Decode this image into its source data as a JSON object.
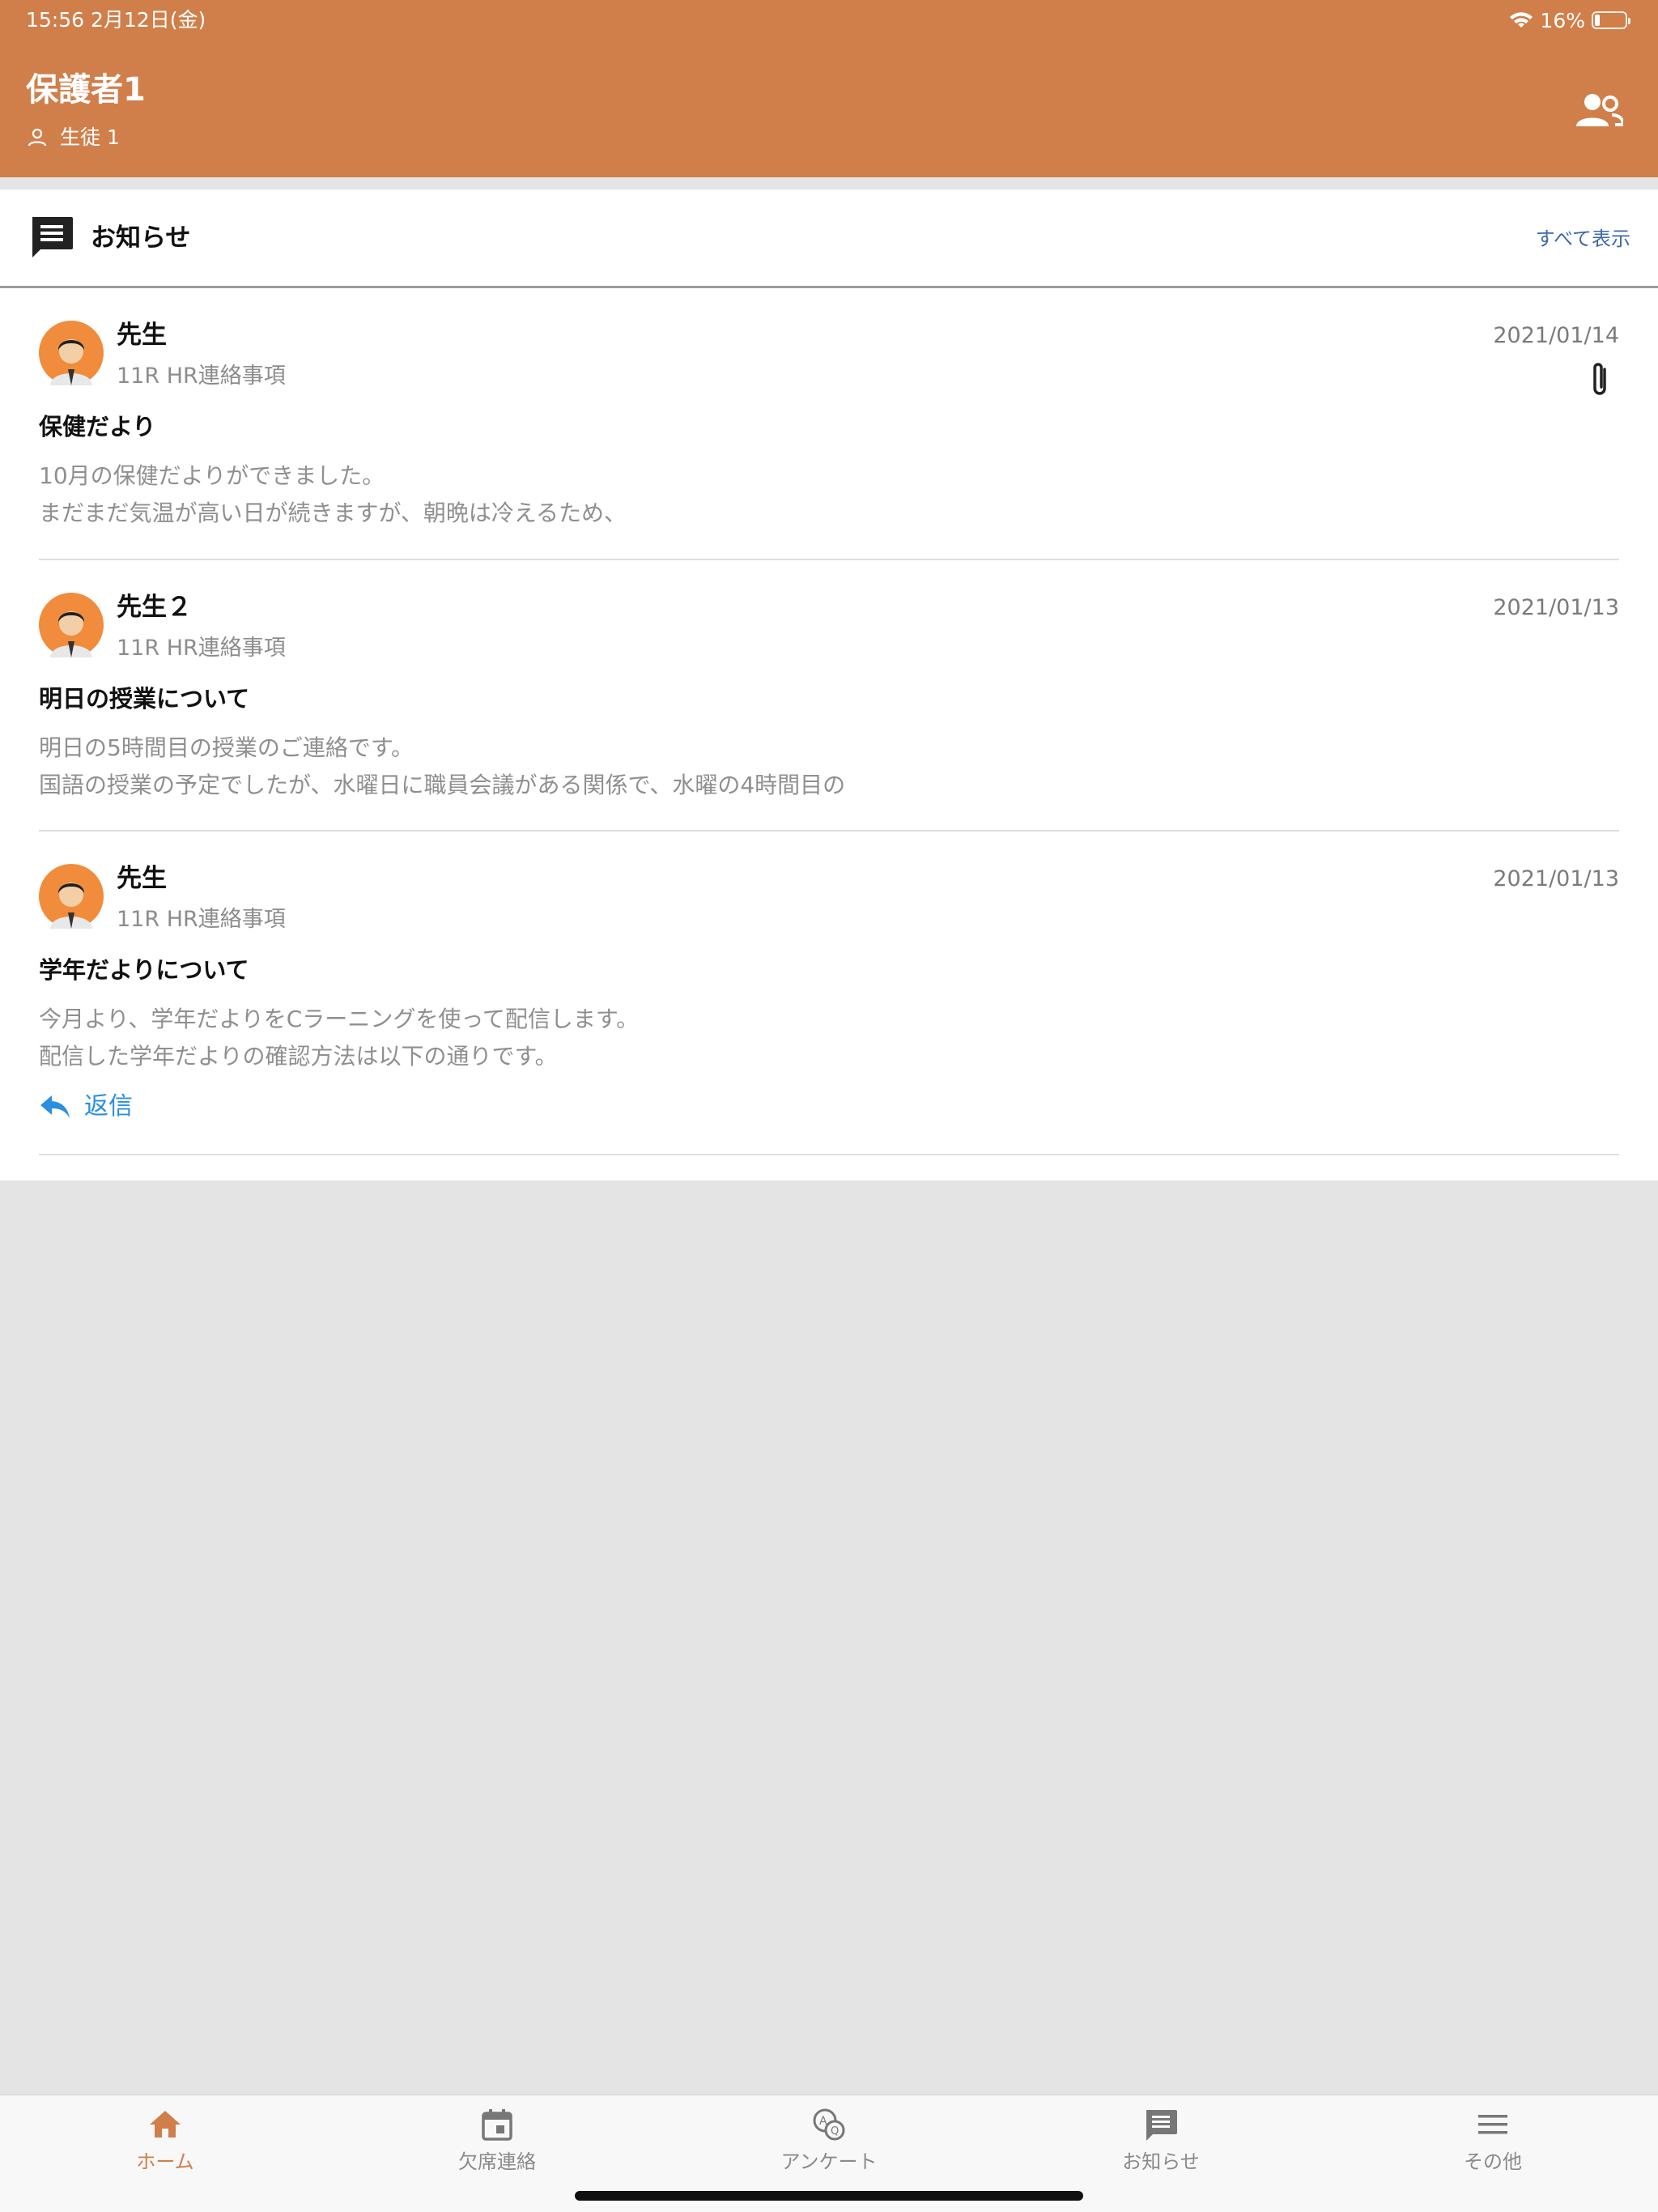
{
  "status_bar": {
    "time_date": "15:56   2月12日(金)",
    "battery_text": "16%",
    "battery_level": 0.16
  },
  "header": {
    "title": "保護者1",
    "student": "生徒 1",
    "background": "#d07f4b"
  },
  "notices": {
    "section_title": "お知らせ",
    "see_all": "すべて表示",
    "items": [
      {
        "sender": "先生",
        "category": "11R HR連絡事項",
        "date": "2021/01/14",
        "subject": "保健だより",
        "body": [
          "10月の保健だよりができました。",
          "まだまだ気温が高い日が続きますが、朝晩は冷えるため、"
        ],
        "has_attachment": true
      },
      {
        "sender": "先生２",
        "category": "11R HR連絡事項",
        "date": "2021/01/13",
        "subject": "明日の授業について",
        "body": [
          "明日の5時間目の授業のご連絡です。",
          "国語の授業の予定でしたが、水曜日に職員会議がある関係で、水曜の4時間目の"
        ],
        "has_attachment": false
      },
      {
        "sender": "先生",
        "category": "11R HR連絡事項",
        "date": "2021/01/13",
        "subject": "学年だよりについて",
        "body": [
          "今月より、学年だよりをCラーニングを使って配信します。",
          "配信した学年だよりの確認方法は以下の通りです。"
        ],
        "has_attachment": false,
        "reply_label": "返信"
      }
    ]
  },
  "tabbar": {
    "active_color": "#d07f4b",
    "tabs": [
      {
        "label": "ホーム",
        "icon": "home-icon",
        "active": true
      },
      {
        "label": "欠席連絡",
        "icon": "calendar-icon",
        "active": false
      },
      {
        "label": "アンケート",
        "icon": "survey-icon",
        "active": false
      },
      {
        "label": "お知らせ",
        "icon": "message-icon",
        "active": false
      },
      {
        "label": "その他",
        "icon": "menu-icon",
        "active": false
      }
    ]
  }
}
